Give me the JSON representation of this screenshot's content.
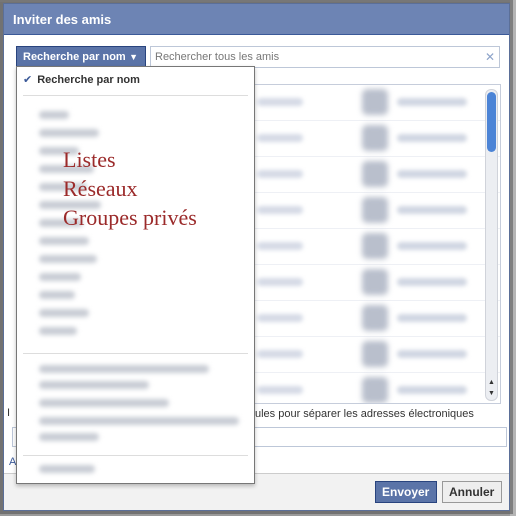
{
  "dialog": {
    "title": "Inviter des amis"
  },
  "search": {
    "filter_label": "Recherche par nom",
    "placeholder": "Rechercher tous les amis"
  },
  "dropdown": {
    "selected_item": "Recherche par nom",
    "annotation_lines": [
      "Listes",
      "Réseaux",
      "Groupes privés"
    ]
  },
  "emails": {
    "label_visible_part": "ules pour séparer les adresses électroniques"
  },
  "side_letters": {
    "i": "I",
    "a": "A"
  },
  "footer": {
    "send_label": "Envoyer",
    "cancel_label": "Annuler"
  },
  "colors": {
    "header": "#6d84b4",
    "primary_button": "#5b74a8",
    "annotation_text": "#9b2a2a",
    "scroll_thumb": "#4c84d6"
  },
  "icons": {
    "clear": "close-icon",
    "caret": "chevron-down-icon",
    "check": "checkmark-icon"
  }
}
